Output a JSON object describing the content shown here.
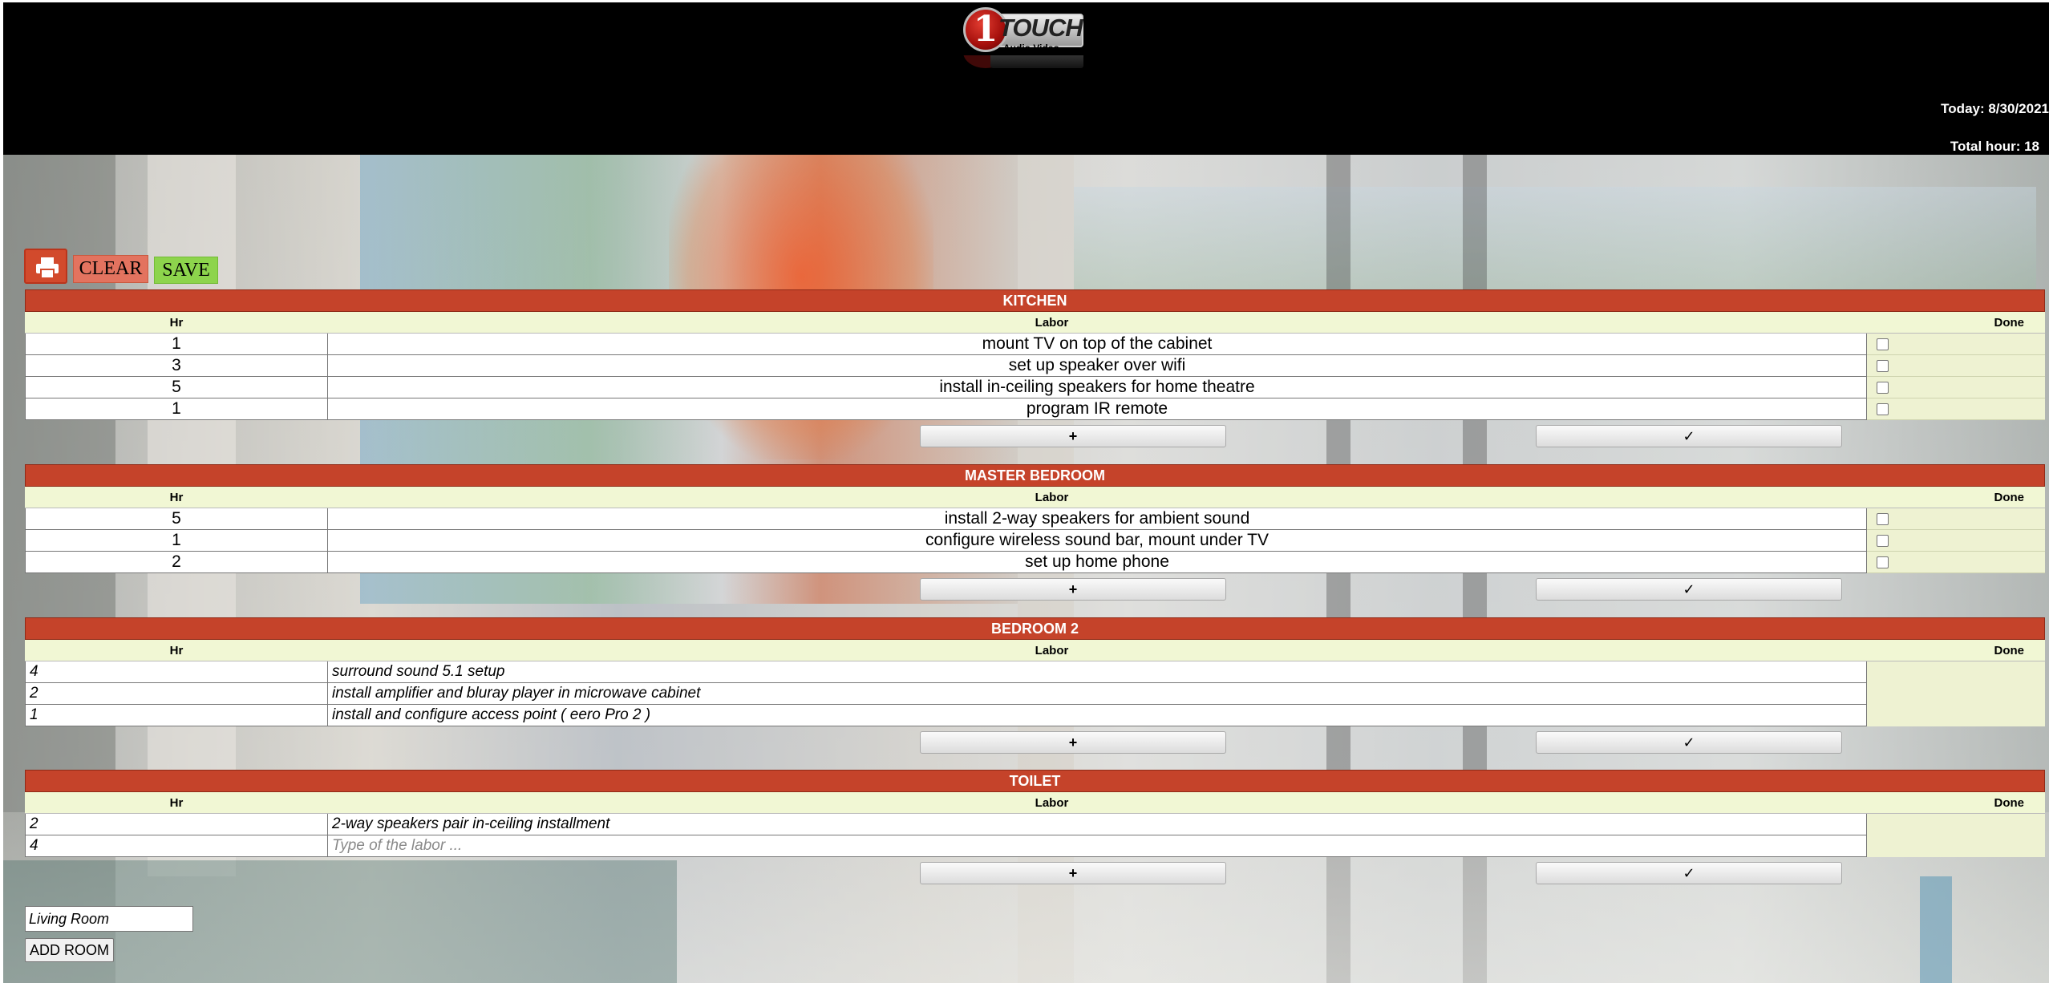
{
  "header": {
    "logo_text": "TOUCH",
    "logo_badge": "1",
    "logo_subtitle": "Audio Video",
    "date_text": "Today: 8/30/2021",
    "total_hours_text": "Total hour: 18"
  },
  "toolbar": {
    "print_icon": "printer-icon",
    "clear_label": "CLEAR",
    "save_label": "SAVE"
  },
  "columns": {
    "hr": "Hr",
    "labor": "Labor",
    "done": "Done"
  },
  "rooms": [
    {
      "title": "KITCHEN",
      "tasks": [
        {
          "hr": "1",
          "labor": "mount TV on top of the cabinet",
          "done": false
        },
        {
          "hr": "3",
          "labor": "set up speaker over wifi",
          "done": false
        },
        {
          "hr": "5",
          "labor": "install in-ceiling speakers for home theatre",
          "done": false
        },
        {
          "hr": "1",
          "labor": "program IR remote",
          "done": false
        }
      ]
    },
    {
      "title": "MASTER BEDROOM",
      "tasks": [
        {
          "hr": "5",
          "labor": "install 2-way speakers for ambient sound",
          "done": false
        },
        {
          "hr": "1",
          "labor": "configure wireless sound bar, mount under TV",
          "done": false
        },
        {
          "hr": "2",
          "labor": "set up home phone",
          "done": false
        }
      ]
    },
    {
      "title": "BEDROOM 2",
      "tasks": [
        {
          "hr": "4",
          "labor": "surround sound 5.1 setup"
        },
        {
          "hr": "2",
          "labor": "install amplifier and bluray player in microwave cabinet"
        },
        {
          "hr": "1",
          "labor": "install and configure access point ( eero Pro 2 )"
        }
      ]
    },
    {
      "title": "TOILET",
      "tasks": [
        {
          "hr": "2",
          "labor": "2-way speakers pair in-ceiling installment"
        },
        {
          "hr": "4",
          "labor": "",
          "placeholder": "Type of the labor ..."
        }
      ]
    }
  ],
  "actions": {
    "add_label": "+",
    "confirm_label": "✓"
  },
  "add_room": {
    "input_value": "Living Room",
    "button_label": "ADD ROOM"
  },
  "colors": {
    "header_bg": "#000000",
    "room_title_bg": "#c5432a",
    "column_header_bg": "#f1f7d4",
    "done_cell_bg": "#eef2d2",
    "clear_button_bg": "#e3735f",
    "save_button_bg": "#8dd44c",
    "print_button_bg": "#d24a2c"
  }
}
